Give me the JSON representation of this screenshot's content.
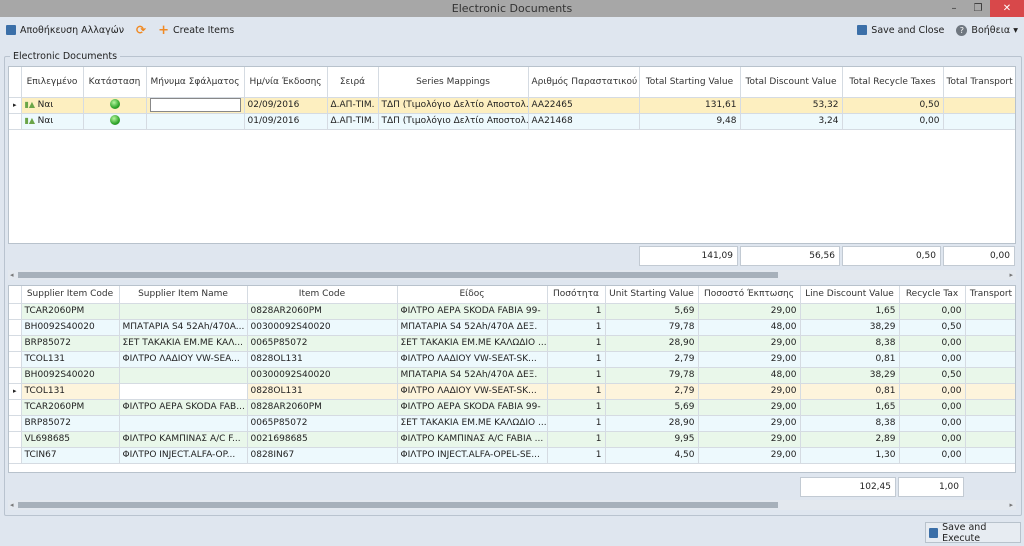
{
  "window": {
    "title": "Electronic Documents",
    "minimize": "–",
    "restore": "❐",
    "close": "✕"
  },
  "toolbar": {
    "save_changes": "Αποθήκευση Αλλαγών",
    "create_items": "Create Items",
    "save_close": "Save and Close",
    "help": "Βοήθεια ▾"
  },
  "group_label": "Electronic Documents",
  "documents": {
    "columns": [
      "Επιλεγμένο",
      "Κατάσταση",
      "Μήνυμα Σφάλματος",
      "Ημ/νία Έκδοσης",
      "Σειρά",
      "Series Mappings",
      "Αριθμός Παραστατικού",
      "Total Starting Value",
      "Total Discount Value",
      "Total Recycle Taxes",
      "Total Transport I"
    ],
    "sort_column": "Ημ/νία Έκδοσης",
    "rows": [
      {
        "selected": "Ναι",
        "status": "ok",
        "error": "",
        "date": "02/09/2016",
        "series": "Δ.ΑΠ-ΤΙΜ.",
        "mapping": "ΤΔΠ (Τιμολόγιο Δελτίο Αποστολ...",
        "number": "AA22465",
        "tsv": "131,61",
        "tdv": "53,32",
        "trt": "0,50",
        "tt": ""
      },
      {
        "selected": "Ναι",
        "status": "ok",
        "error": "",
        "date": "01/09/2016",
        "series": "Δ.ΑΠ-ΤΙΜ.",
        "mapping": "ΤΔΠ (Τιμολόγιο Δελτίο Αποστολ...",
        "number": "AA21468",
        "tsv": "9,48",
        "tdv": "3,24",
        "trt": "0,00",
        "tt": ""
      }
    ],
    "totals": [
      "141,09",
      "56,56",
      "0,50",
      "0,00"
    ]
  },
  "items": {
    "columns": [
      "Supplier Item Code",
      "Supplier Item Name",
      "Item Code",
      "Είδος",
      "Ποσότητα",
      "Unit Starting Value",
      "Ποσοστό Έκπτωσης",
      "Line Discount Value",
      "Recycle Tax",
      "Transport F"
    ],
    "rows": [
      [
        "TCAR2060PM",
        "",
        "0828AR2060PM",
        "ΦΙΛΤΡΟ ΑΕΡΑ SKODA FABIA 99-",
        "1",
        "5,69",
        "29,00",
        "1,65",
        "0,00",
        ""
      ],
      [
        "BH0092S40020",
        "ΜΠΑΤΑΡΙΑ S4 52Ah/470A...",
        "00300092S40020",
        "ΜΠΑΤΑΡΙΑ S4 52Ah/470A ΔΕΞ.",
        "1",
        "79,78",
        "48,00",
        "38,29",
        "0,50",
        ""
      ],
      [
        "BRP85072",
        "ΣΕΤ ΤΑΚΑΚΙΑ ΕΜ.ΜΕ ΚΑΛ...",
        "0065P85072",
        "ΣΕΤ ΤΑΚΑΚΙΑ ΕΜ.ΜΕ ΚΑΛΩΔΙΟ ...",
        "1",
        "28,90",
        "29,00",
        "8,38",
        "0,00",
        ""
      ],
      [
        "TCOL131",
        "ΦΙΛΤΡΟ ΛΑΔΙΟΥ VW-SEA...",
        "0828OL131",
        "ΦΙΛΤΡΟ ΛΑΔΙΟΥ VW-SEAT-SK...",
        "1",
        "2,79",
        "29,00",
        "0,81",
        "0,00",
        ""
      ],
      [
        "BH0092S40020",
        "",
        "00300092S40020",
        "ΜΠΑΤΑΡΙΑ S4 52Ah/470A ΔΕΞ.",
        "1",
        "79,78",
        "48,00",
        "38,29",
        "0,50",
        ""
      ],
      [
        "TCOL131",
        "",
        "0828OL131",
        "ΦΙΛΤΡΟ ΛΑΔΙΟΥ VW-SEAT-SK...",
        "1",
        "2,79",
        "29,00",
        "0,81",
        "0,00",
        ""
      ],
      [
        "TCAR2060PM",
        "ΦΙΛΤΡΟ ΑΕΡΑ SKODA FAB...",
        "0828AR2060PM",
        "ΦΙΛΤΡΟ ΑΕΡΑ SKODA FABIA 99-",
        "1",
        "5,69",
        "29,00",
        "1,65",
        "0,00",
        ""
      ],
      [
        "BRP85072",
        "",
        "0065P85072",
        "ΣΕΤ ΤΑΚΑΚΙΑ ΕΜ.ΜΕ ΚΑΛΩΔΙΟ ...",
        "1",
        "28,90",
        "29,00",
        "8,38",
        "0,00",
        ""
      ],
      [
        "VL698685",
        "ΦΙΛΤΡΟ ΚΑΜΠΙΝΑΣ A/C F...",
        "0021698685",
        "ΦΙΛΤΡΟ ΚΑΜΠΙΝΑΣ A/C FABIA ...",
        "1",
        "9,95",
        "29,00",
        "2,89",
        "0,00",
        ""
      ],
      [
        "TCIN67",
        "ΦΙΛΤΡΟ INJECT.ALFA-OP...",
        "0828IN67",
        "ΦΙΛΤΡΟ INJECT.ALFA-OPEL-SE...",
        "1",
        "4,50",
        "29,00",
        "1,30",
        "0,00",
        ""
      ]
    ],
    "current_row": 5,
    "totals": [
      "102,45",
      "1,00"
    ]
  },
  "footer": {
    "save_execute": "Save and Execute"
  },
  "colors": {
    "row_green": "#e9f7ea",
    "row_blue": "#edf9fd",
    "row_selected": "#fdefc0",
    "accent": "#f08a24"
  }
}
